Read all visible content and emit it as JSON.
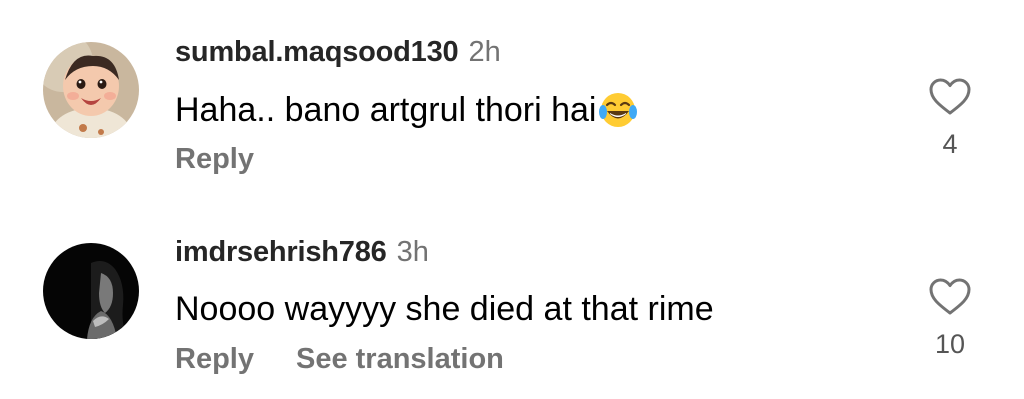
{
  "comments": [
    {
      "username": "sumbal.maqsood130",
      "time": "2h",
      "text": "Haha.. bano artgrul thori hai",
      "emoji": "face-with-tears-of-joy",
      "reply_label": "Reply",
      "like_count": "4"
    },
    {
      "username": "imdrsehrish786",
      "time": "3h",
      "text": "Noooo wayyyy she died at that rime",
      "reply_label": "Reply",
      "translation_label": "See translation",
      "like_count": "10"
    }
  ],
  "icons": {
    "like": "heart-outline-icon",
    "emoji": "laughing-tears-emoji"
  },
  "colors": {
    "username": "#262626",
    "secondary_text": "#737373",
    "comment_text": "#000000"
  }
}
